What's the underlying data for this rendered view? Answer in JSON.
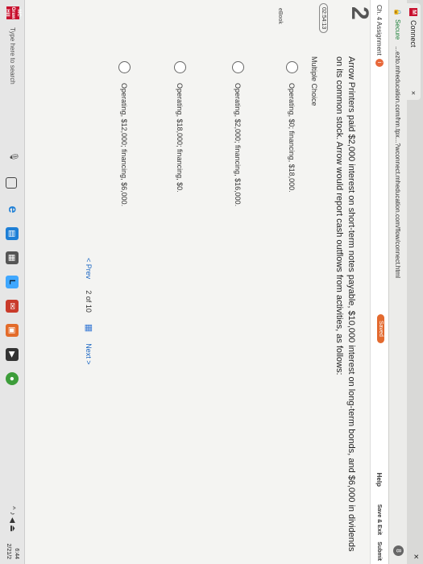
{
  "browser": {
    "tab_title": "Connect",
    "tab_favicon": "M",
    "tab_close": "×",
    "window_close": "×",
    "secure_label": "Secure",
    "url": "...ezto.mheducation.com/hm.tpx...?wconnect.mheducation.com/flow/connect.html",
    "profile_initial": "8"
  },
  "app_header": {
    "chapter": "Ch. 4 Assignment",
    "info_icon": "i",
    "saved_label": "Saved",
    "help_label": "Help",
    "save_exit_label": "Save & Exit",
    "submit_label": "Submit"
  },
  "question": {
    "number": "2",
    "points": "02:54:13",
    "ebook_label": "eBook",
    "text": "Arrow Printers paid $2,000 interest on short-term notes payable, $10,000 interest on long-term bonds, and $6,000 in dividends on its common stock. Arrow would report cash outflows from activities, as follows:",
    "type_label": "Multiple Choice",
    "options": [
      "Operating, $0; financing, $18,000.",
      "Operating, $2,000; financing, $16,000.",
      "Operating, $18,000; financing, $0.",
      "Operating, $12,000; financing, $6,000."
    ]
  },
  "pager": {
    "prev_label": "< Prev",
    "current": "2",
    "of_label": "of",
    "total": "10",
    "next_label": "Next >"
  },
  "taskbar": {
    "start_label": "MC Graw Hill",
    "search_placeholder": "Type here to search",
    "tray": "^ ♪ ◀ ⏏",
    "time": "6:44",
    "date": "2/21/2"
  }
}
